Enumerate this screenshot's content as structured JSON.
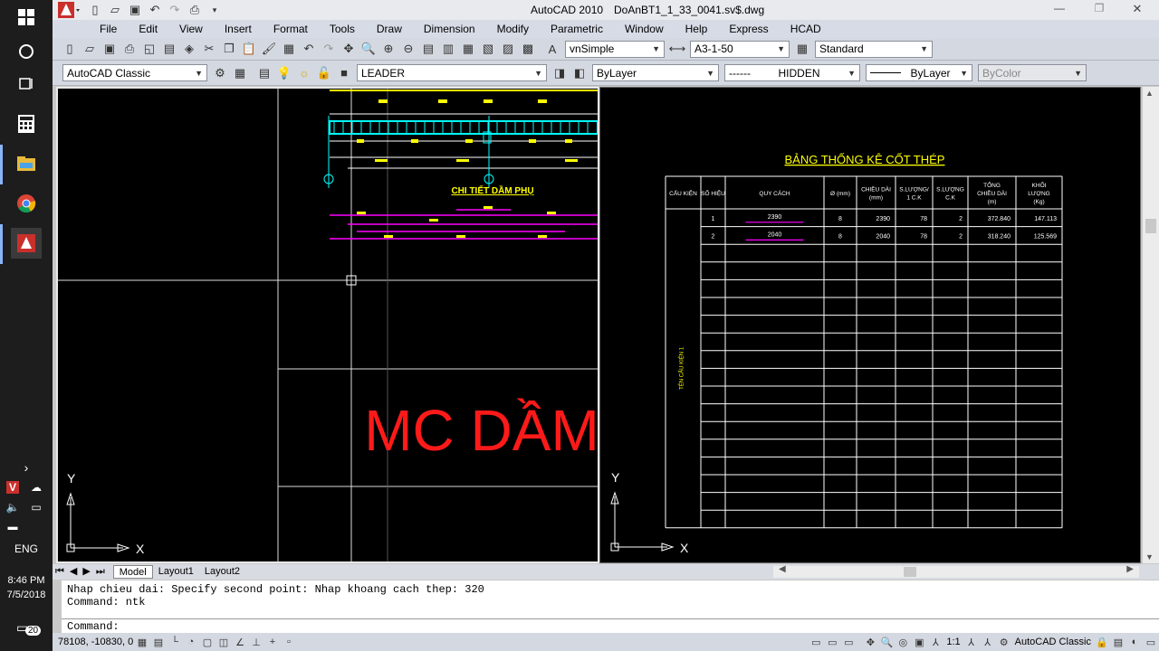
{
  "window": {
    "app_title": "AutoCAD 2010",
    "file_title": "DoAnBT1_1_33_0041.sv$.dwg",
    "minimize_glyph": "—",
    "maximize_glyph": "❐",
    "close_glyph": "✕"
  },
  "menu": [
    "File",
    "Edit",
    "View",
    "Insert",
    "Format",
    "Tools",
    "Draw",
    "Dimension",
    "Modify",
    "Parametric",
    "Window",
    "Help",
    "Express",
    "HCAD"
  ],
  "toolbar1": {
    "text_style": "vnSimple",
    "dim_style": "A3-1-50",
    "table_style": "Standard"
  },
  "toolbar2": {
    "workspace": "AutoCAD Classic",
    "layer": "LEADER",
    "color": "ByLayer",
    "linetype_dashes": "------",
    "linetype": "HIDDEN",
    "lineweight": "ByLayer",
    "plotstyle": "ByColor"
  },
  "drawing": {
    "detail_title": "CHI TIẾT DẦM PHỤ",
    "big_label": "MC DẦM",
    "ucs_x": "X",
    "ucs_y": "Y"
  },
  "table": {
    "title": "BẢNG THỐNG KÊ CỐT THÉP",
    "headers": [
      "CẤU KIỆN",
      "SỐ HIỆU",
      "QUY CÁCH",
      "Ø (mm)",
      "CHIỀU DÀI (mm)",
      "S.LƯỢNG/ 1 C.K",
      "S.LƯỢNG C.K",
      "TỔNG CHIỀU DÀI (m)",
      "KHỐI LƯỢNG (Kg)"
    ],
    "side_label": "TÊN CẤU KIỆN 1",
    "rows": [
      [
        "",
        "1",
        "2390",
        "8",
        "2390",
        "78",
        "2",
        "372.840",
        "147.113"
      ],
      [
        "",
        "2",
        "2040",
        "8",
        "2040",
        "78",
        "2",
        "318.240",
        "125.569"
      ]
    ]
  },
  "tabs": [
    "Model",
    "Layout1",
    "Layout2"
  ],
  "command": {
    "history1": "Nhap chieu dai:  Specify second point: Nhap khoang cach thep: 320",
    "history2": "Command: ntk",
    "prompt": "Command:"
  },
  "status": {
    "coords": "78108, -10830, 0",
    "annotation_scale": "1:1",
    "workspace": "AutoCAD Classic"
  },
  "taskbar": {
    "language": "ENG",
    "time": "8:46 PM",
    "date": "7/5/2018",
    "notifications": "20"
  }
}
